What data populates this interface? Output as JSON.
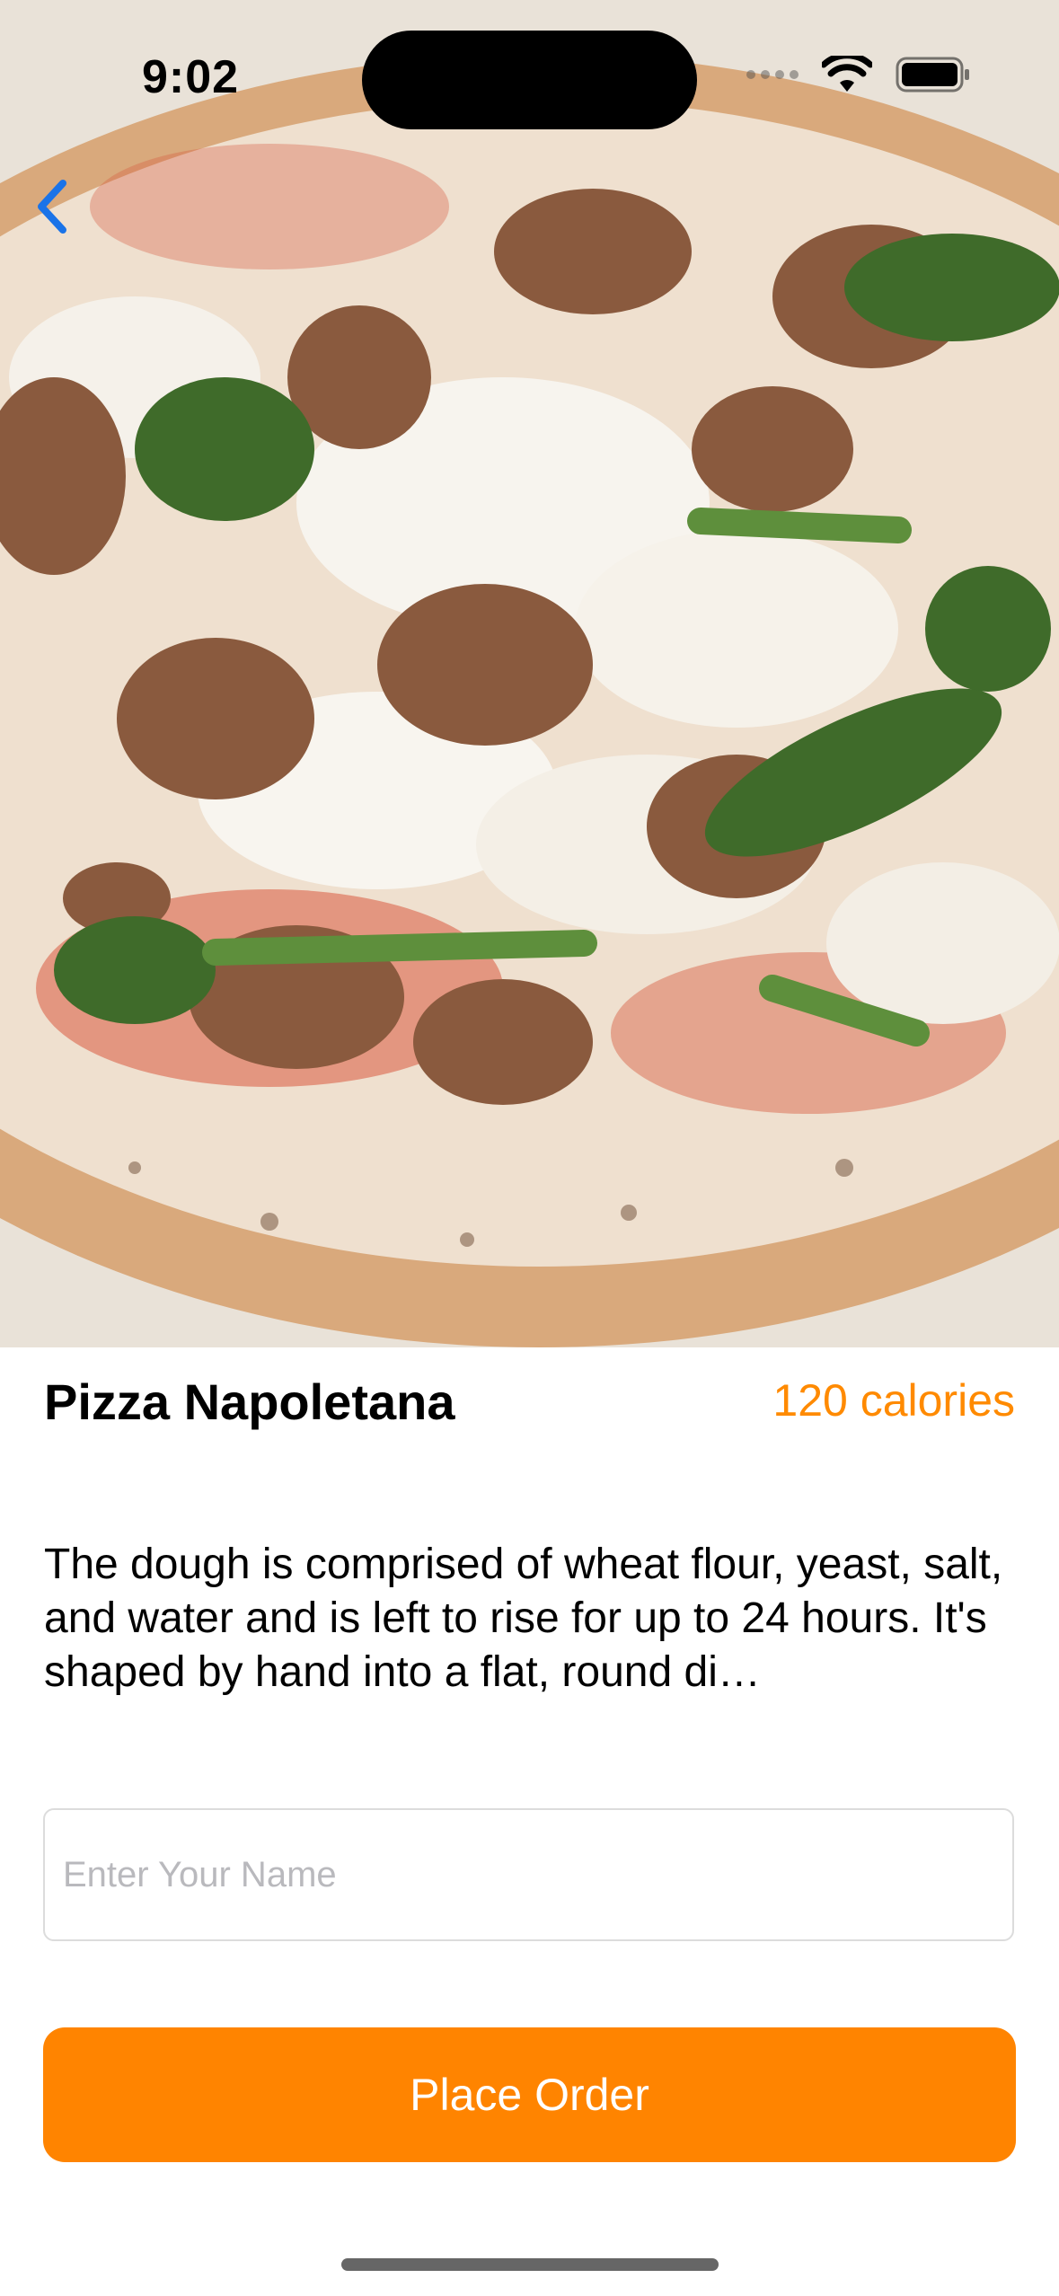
{
  "status_bar": {
    "time": "9:02"
  },
  "icons": {
    "back": "chevron-left-icon",
    "wifi": "wifi-icon",
    "battery": "battery-icon",
    "signal": "cellular-signal-icon"
  },
  "hero": {
    "image": "pizza-photo"
  },
  "product": {
    "title": "Pizza Napoletana",
    "calories": "120 calories",
    "description": "The dough is comprised of wheat flour, yeast, salt, and water and is left to rise for up to 24 hours. It's shaped by hand into a flat, round di…"
  },
  "form": {
    "name_placeholder": "Enter Your Name",
    "name_value": ""
  },
  "actions": {
    "place_order_label": "Place Order"
  },
  "colors": {
    "accent": "#FF8400",
    "link": "#1a73e8"
  }
}
